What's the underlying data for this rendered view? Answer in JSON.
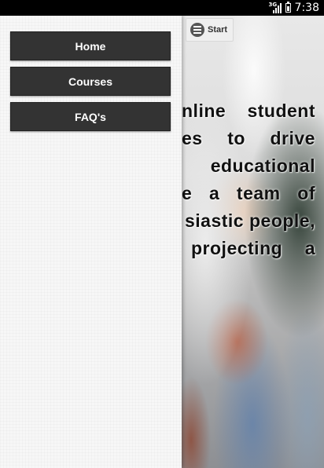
{
  "status_bar": {
    "network": "3G",
    "time": "7:38"
  },
  "drawer": {
    "items": [
      {
        "label": "Home"
      },
      {
        "label": "Courses"
      },
      {
        "label": "FAQ's"
      }
    ]
  },
  "header": {
    "start_label": "Start"
  },
  "content": {
    "lines": [
      [
        "nline",
        "student"
      ],
      [
        "es",
        "to",
        "drive"
      ],
      [
        "educational"
      ],
      [
        "e",
        "a",
        "team",
        "of"
      ],
      [
        "siastic people,"
      ],
      [
        "projecting",
        "a"
      ]
    ]
  }
}
